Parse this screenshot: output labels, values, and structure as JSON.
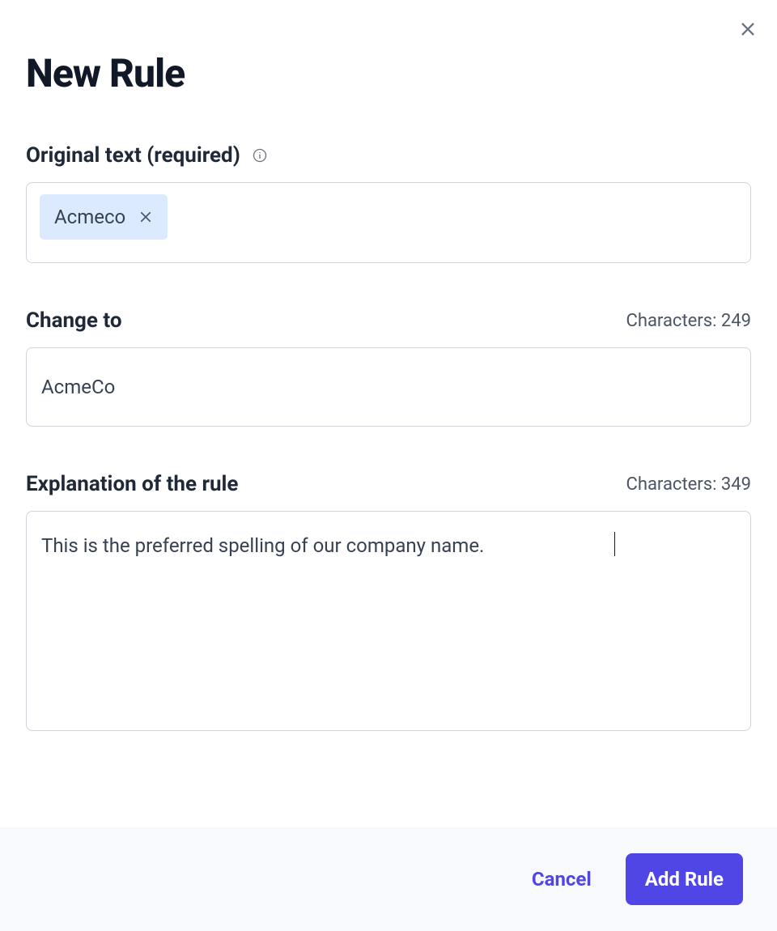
{
  "dialog": {
    "title": "New Rule"
  },
  "fields": {
    "original_text": {
      "label": "Original text (required)",
      "tag_value": "Acmeco"
    },
    "change_to": {
      "label": "Change to",
      "char_count": "Characters: 249",
      "value": "AcmeCo"
    },
    "explanation": {
      "label": "Explanation of the rule",
      "char_count": "Characters: 349",
      "value": "This is the preferred spelling of our company name."
    }
  },
  "footer": {
    "cancel_label": "Cancel",
    "submit_label": "Add Rule"
  }
}
